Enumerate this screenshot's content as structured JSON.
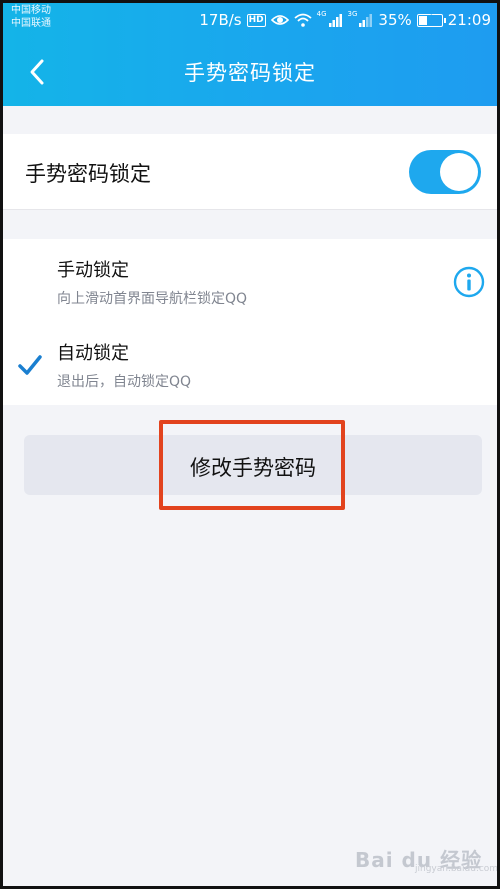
{
  "status_bar": {
    "carrier_1": "中国移动",
    "carrier_2": "中国联通",
    "net_speed": "17B/s",
    "hd_badge": "HD",
    "net_tag_1": "4G",
    "net_tag_2": "3G",
    "battery_percent": "35%",
    "battery_level": 0.35,
    "time": "21:09"
  },
  "navbar": {
    "title": "手势密码锁定",
    "back_icon": "chevron-left-icon"
  },
  "master_toggle": {
    "label": "手势密码锁定",
    "enabled": true
  },
  "lock_options": [
    {
      "title": "手动锁定",
      "description": "向上滑动首界面导航栏锁定QQ",
      "selected": false,
      "icon": "info-icon"
    },
    {
      "title": "自动锁定",
      "description": "退出后，自动锁定QQ",
      "selected": true,
      "icon": "check-icon"
    }
  ],
  "change_button": {
    "label": "修改手势密码"
  },
  "watermark": {
    "text": "Bai du 经验",
    "subtext": "jingyan.baidu.com"
  },
  "colors": {
    "accent": "#1ea8ee",
    "highlight_border": "#e2431e",
    "background": "#f3f4f8"
  }
}
